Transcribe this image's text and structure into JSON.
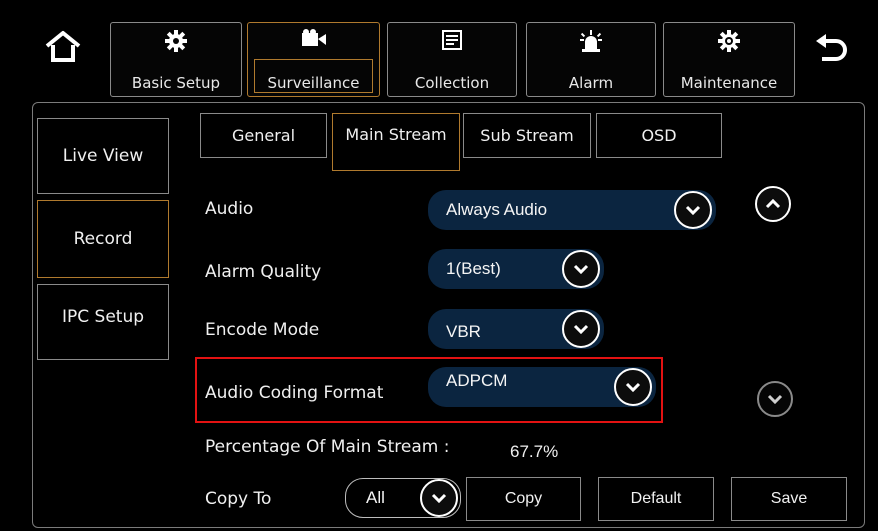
{
  "topbar": {
    "home_icon": "home-icon",
    "back_icon": "back-arrow-icon",
    "tabs": [
      {
        "label": "Basic Setup",
        "icon": "gear-icon"
      },
      {
        "label": "Surveillance",
        "icon": "video-camera-icon",
        "active": true
      },
      {
        "label": "Collection",
        "icon": "list-icon"
      },
      {
        "label": "Alarm",
        "icon": "alarm-light-icon"
      },
      {
        "label": "Maintenance",
        "icon": "maintenance-gear-icon"
      }
    ]
  },
  "sidebar": {
    "items": [
      {
        "label": "Live View"
      },
      {
        "label": "Record",
        "active": true
      },
      {
        "label": "IPC Setup"
      }
    ]
  },
  "subtabs": [
    {
      "label": "General"
    },
    {
      "label": "Main Stream",
      "active": true
    },
    {
      "label": "Sub Stream"
    },
    {
      "label": "OSD"
    }
  ],
  "fields": {
    "audio": {
      "label": "Audio",
      "value": "Always Audio"
    },
    "alarm_quality": {
      "label": "Alarm Quality",
      "value": "1(Best)"
    },
    "encode_mode": {
      "label": "Encode Mode",
      "value": "VBR"
    },
    "audio_coding_format": {
      "label": "Audio Coding Format",
      "value": "ADPCM"
    }
  },
  "percentage": {
    "label": "Percentage Of Main Stream :",
    "value": "67.7%"
  },
  "copy": {
    "label": "Copy To",
    "value": "All"
  },
  "buttons": {
    "copy": "Copy",
    "default": "Default",
    "save": "Save"
  },
  "colors": {
    "active_border": "#b07a2e",
    "highlight": "#e31212",
    "dropdown_bg": "#0b2540"
  }
}
